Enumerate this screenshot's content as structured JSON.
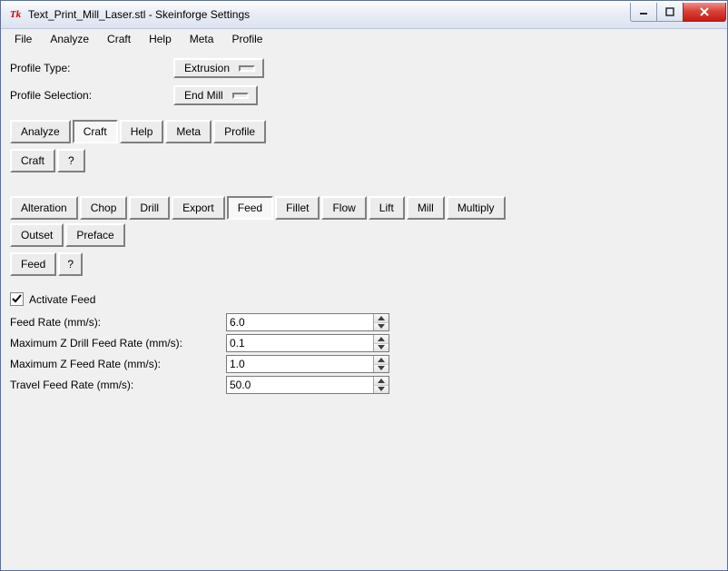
{
  "window": {
    "title": "Text_Print_Mill_Laser.stl - Skeinforge Settings",
    "icon_label": "Tk"
  },
  "menubar": [
    "File",
    "Analyze",
    "Craft",
    "Help",
    "Meta",
    "Profile"
  ],
  "profile": {
    "type_label": "Profile Type:",
    "type_value": "Extrusion",
    "selection_label": "Profile Selection:",
    "selection_value": "End Mill"
  },
  "main_tabs": {
    "items": [
      {
        "label": "Analyze",
        "active": false
      },
      {
        "label": "Craft",
        "active": true
      },
      {
        "label": "Help",
        "active": false
      },
      {
        "label": "Meta",
        "active": false
      },
      {
        "label": "Profile",
        "active": false
      }
    ]
  },
  "craft_sub": {
    "button": "Craft",
    "help": "?"
  },
  "craft_tabs": {
    "row1": [
      {
        "label": "Alteration",
        "active": false
      },
      {
        "label": "Chop",
        "active": false
      },
      {
        "label": "Drill",
        "active": false
      },
      {
        "label": "Export",
        "active": false
      },
      {
        "label": "Feed",
        "active": true
      },
      {
        "label": "Fillet",
        "active": false
      },
      {
        "label": "Flow",
        "active": false
      },
      {
        "label": "Lift",
        "active": false
      },
      {
        "label": "Mill",
        "active": false
      },
      {
        "label": "Multiply",
        "active": false
      }
    ],
    "row2": [
      {
        "label": "Outset",
        "active": false
      },
      {
        "label": "Preface",
        "active": false
      }
    ]
  },
  "feed_sub": {
    "button": "Feed",
    "help": "?"
  },
  "feed_form": {
    "activate_label": "Activate Feed",
    "activate_checked": true,
    "fields": [
      {
        "label": "Feed Rate (mm/s):",
        "value": "6.0",
        "highlight": "yellow"
      },
      {
        "label": "Maximum Z Drill Feed Rate (mm/s):",
        "value": "0.1",
        "highlight": "none"
      },
      {
        "label": "Maximum Z Feed Rate (mm/s):",
        "value": "1.0",
        "highlight": "none"
      },
      {
        "label": "Travel Feed Rate (mm/s):",
        "value": "50.0",
        "highlight": "cyan"
      }
    ]
  },
  "colors": {
    "yellow": "#ffff00",
    "cyan": "#00ffff"
  }
}
